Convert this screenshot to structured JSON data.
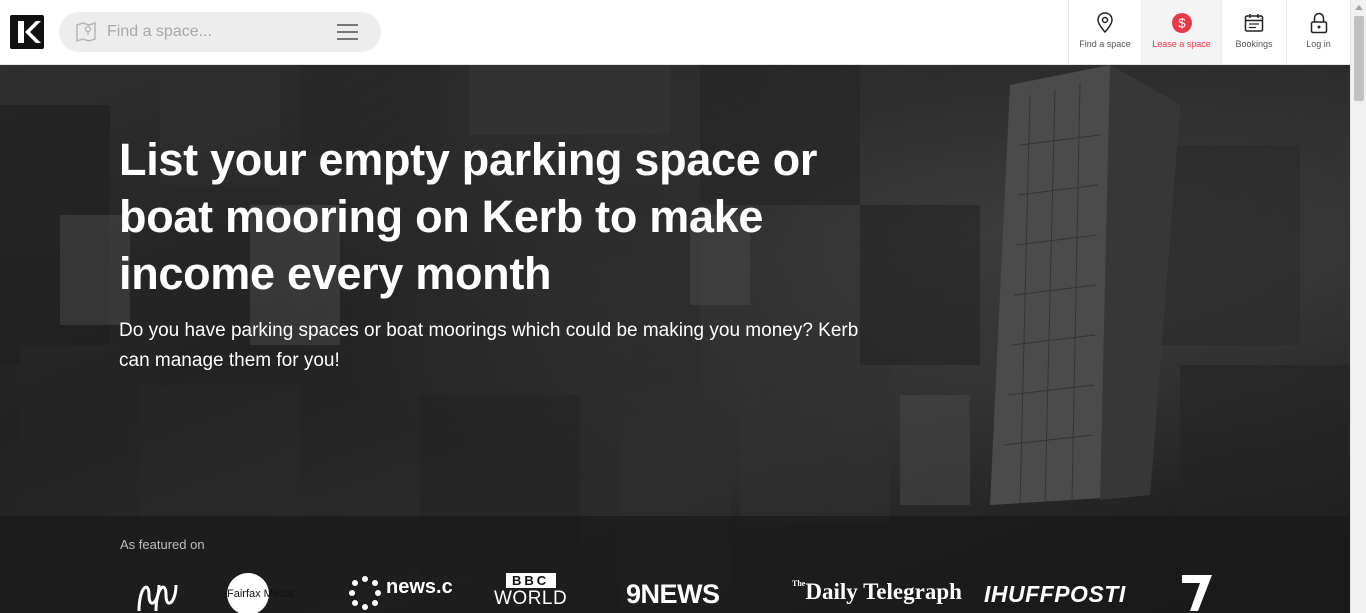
{
  "header": {
    "logo_icon": "kerb-logo-icon",
    "search": {
      "placeholder": "Find a space...",
      "value": ""
    },
    "nav": [
      {
        "label": "Find a space",
        "icon": "map-pin-icon"
      },
      {
        "label": "Lease a space",
        "icon": "dollar-icon",
        "accent": "#e8394b"
      },
      {
        "label": "Bookings",
        "icon": "calendar-icon"
      },
      {
        "label": "Log in",
        "icon": "lock-icon"
      }
    ]
  },
  "hero": {
    "title": "List your empty parking space or boat mooring on Kerb to make income every month",
    "subtitle": "Do you have parking spaces or boat moorings which could be making you money? Kerb can manage them for you!"
  },
  "featured": {
    "label": "As featured on",
    "press": [
      {
        "name": "ABC",
        "icon": "abc-logo-icon"
      },
      {
        "name": "Fairfax Media"
      },
      {
        "name": "news.com.au"
      },
      {
        "name": "BBC",
        "sub": "WORLD"
      },
      {
        "name": "9NEWS"
      },
      {
        "name": "Daily Telegraph",
        "prefix": "The"
      },
      {
        "name": "IHUFFPOSTI"
      },
      {
        "name": "Seven",
        "icon": "seven-logo-icon"
      }
    ]
  },
  "colors": {
    "accent": "#e8394b",
    "header_bg": "#ffffff",
    "search_bg": "#ededed"
  }
}
